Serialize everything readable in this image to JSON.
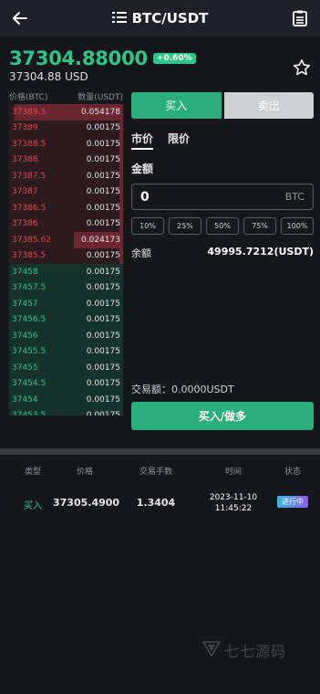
{
  "header": {
    "title": "BTC/USDT"
  },
  "ticker": {
    "price": "37304.88000",
    "change": "+0.60%",
    "usd": "37304.88 USD"
  },
  "book": {
    "head_price": "价格(BTC)",
    "head_qty": "数量(USDT)",
    "asks": [
      {
        "p": "37389.5",
        "q": "0.054178",
        "fill": 0.95
      },
      {
        "p": "37389",
        "q": "0.00175",
        "fill": 0.03
      },
      {
        "p": "37388.5",
        "q": "0.00175",
        "fill": 0.03
      },
      {
        "p": "37388",
        "q": "0.00175",
        "fill": 0.03
      },
      {
        "p": "37387.5",
        "q": "0.00175",
        "fill": 0.03
      },
      {
        "p": "37387",
        "q": "0.00175",
        "fill": 0.03
      },
      {
        "p": "37386.5",
        "q": "0.00175",
        "fill": 0.03
      },
      {
        "p": "37386",
        "q": "0.00175",
        "fill": 0.03
      },
      {
        "p": "37385.62",
        "q": "0.024173",
        "fill": 0.43
      },
      {
        "p": "37385.5",
        "q": "0.00175",
        "fill": 0.03
      }
    ],
    "bids": [
      {
        "p": "37458",
        "q": "0.00175"
      },
      {
        "p": "37457.5",
        "q": "0.00175"
      },
      {
        "p": "37457",
        "q": "0.00175"
      },
      {
        "p": "37456.5",
        "q": "0.00175"
      },
      {
        "p": "37456",
        "q": "0.00175"
      },
      {
        "p": "37455.5",
        "q": "0.00175"
      },
      {
        "p": "37455",
        "q": "0.00175"
      },
      {
        "p": "37454.5",
        "q": "0.00175"
      },
      {
        "p": "37454",
        "q": "0.00175"
      },
      {
        "p": "37453.5",
        "q": "0.00175"
      }
    ]
  },
  "trade": {
    "buy_tab": "买入",
    "sell_tab": "卖出",
    "market": "市价",
    "limit": "限价",
    "amount_label": "金额",
    "amount_value": "0",
    "amount_unit": "BTC",
    "pcts": [
      "10%",
      "25%",
      "50%",
      "75%",
      "100%"
    ],
    "balance_label": "余额",
    "balance_value": "49995.7212(USDT)",
    "tx_amount": "交易额：0.0000USDT",
    "submit": "买入/做多"
  },
  "orders": {
    "headers": [
      "类型",
      "价格",
      "交易手数",
      "时间",
      "状态"
    ],
    "row": {
      "type": "买入",
      "price": "37305.4900",
      "lots": "1.3404",
      "date": "2023-11-10",
      "time": "11:45:22",
      "status": "进行中"
    }
  },
  "watermark": "七七源码",
  "colors": {
    "green": "#2fc489",
    "red": "#e34a4f",
    "bg": "#16171b"
  }
}
